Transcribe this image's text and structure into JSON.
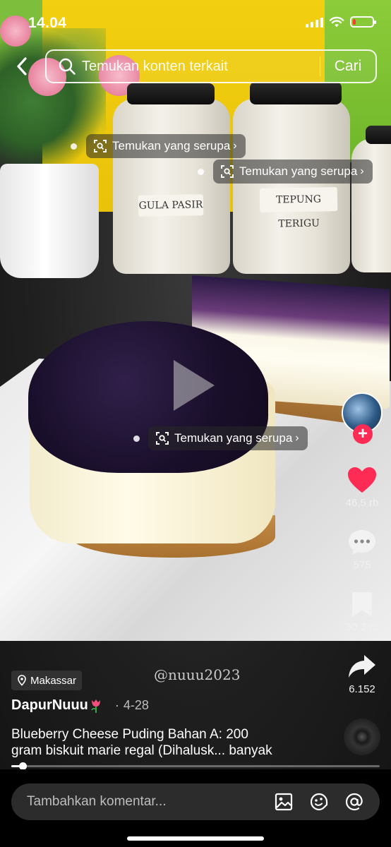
{
  "status_bar": {
    "time": "14.04",
    "battery_level": 0.1,
    "battery_color": "#ff3b30"
  },
  "search": {
    "placeholder": "Temukan konten terkait",
    "submit_label": "Cari",
    "back_icon": "chevron-left-icon",
    "search_icon": "search-icon"
  },
  "similar_chips": [
    {
      "label": "Temukan yang serupa"
    },
    {
      "label": "Temukan yang serupa"
    },
    {
      "label": "Temukan yang serupa"
    }
  ],
  "video": {
    "play_icon": "play-icon",
    "watermark": "@nuuu2023",
    "jar_labels": [
      "GULA PASIR",
      "TEPUNG TERIGU"
    ],
    "progress": 0.03
  },
  "actions": {
    "follow_label": "+",
    "likes": {
      "count": "46,5 rb",
      "icon": "heart-icon",
      "color": "#fe2c55"
    },
    "comments": {
      "count": "575",
      "icon": "comment-icon"
    },
    "saves": {
      "count": "30,3 rb",
      "icon": "bookmark-icon"
    },
    "shares": {
      "count": "6.152",
      "icon": "share-icon"
    }
  },
  "post": {
    "location": "Makassar",
    "author": "DapurNuuu",
    "date": "4-28",
    "caption_line1": "Blueberry Cheese Puding Bahan A: 200",
    "caption_line2": "gram biskuit marie regal (Dihalusk... banyak"
  },
  "comment_bar": {
    "placeholder": "Tambahkan komentar...",
    "tools": [
      "image-icon",
      "emoji-icon",
      "mention-icon"
    ]
  }
}
